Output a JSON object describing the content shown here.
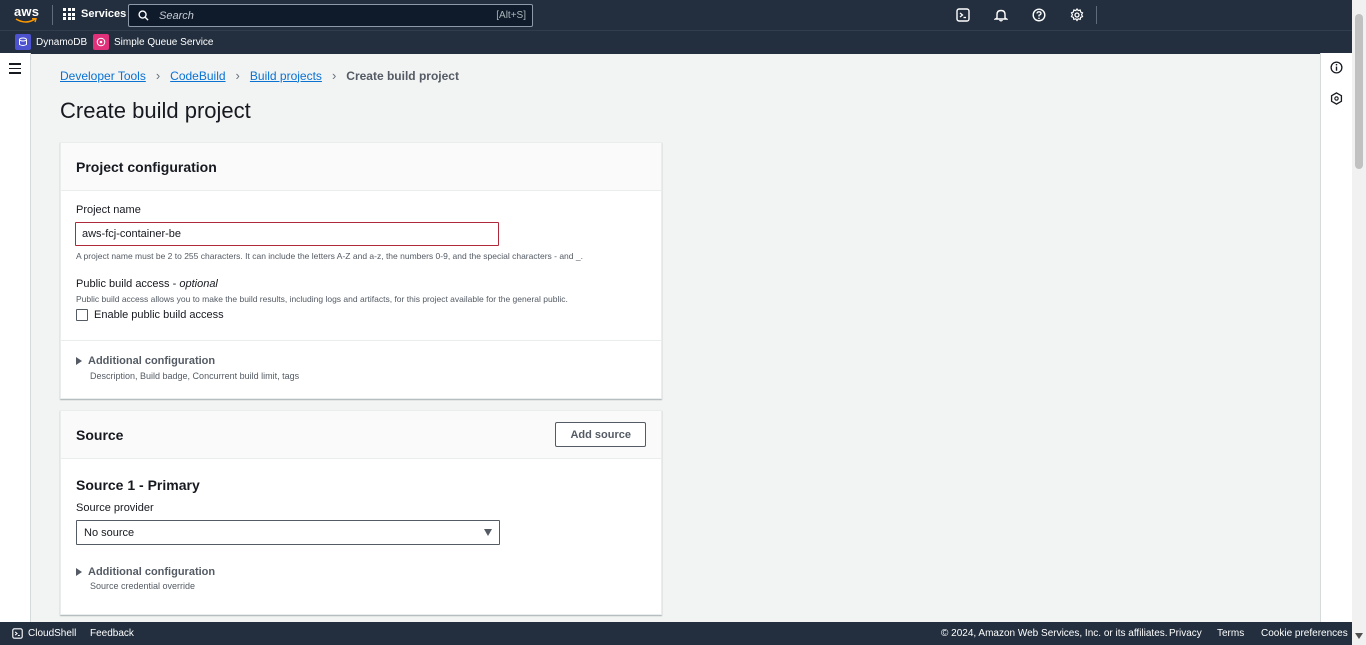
{
  "topnav": {
    "logo_text": "aws",
    "services_label": "Services",
    "search_placeholder": "Search",
    "search_shortcut": "[Alt+S]"
  },
  "favorites": [
    {
      "label": "DynamoDB",
      "color": "#4d52cf"
    },
    {
      "label": "Simple Queue Service",
      "color": "#e0317a"
    }
  ],
  "breadcrumb": {
    "items": [
      "Developer Tools",
      "CodeBuild",
      "Build projects"
    ],
    "current": "Create build project"
  },
  "page_title": "Create build project",
  "project_config": {
    "title": "Project configuration",
    "name_label": "Project name",
    "name_value": "aws-fcj-container-be",
    "name_hint": "A project name must be 2 to 255 characters. It can include the letters A-Z and a-z, the numbers 0-9, and the special characters - and _.",
    "public_label": "Public build access -",
    "public_optional": "optional",
    "public_hint": "Public build access allows you to make the build results, including logs and artifacts, for this project available for the general public.",
    "public_checkbox": "Enable public build access",
    "additional_title": "Additional configuration",
    "additional_desc": "Description, Build badge, Concurrent build limit, tags"
  },
  "source": {
    "title": "Source",
    "add_button": "Add source",
    "primary_title": "Source 1 - Primary",
    "provider_label": "Source provider",
    "provider_value": "No source",
    "additional_title": "Additional configuration",
    "additional_desc": "Source credential override"
  },
  "footer": {
    "cloudshell": "CloudShell",
    "feedback": "Feedback",
    "copyright": "© 2024, Amazon Web Services, Inc. or its affiliates.",
    "privacy": "Privacy",
    "terms": "Terms",
    "cookies": "Cookie preferences"
  }
}
